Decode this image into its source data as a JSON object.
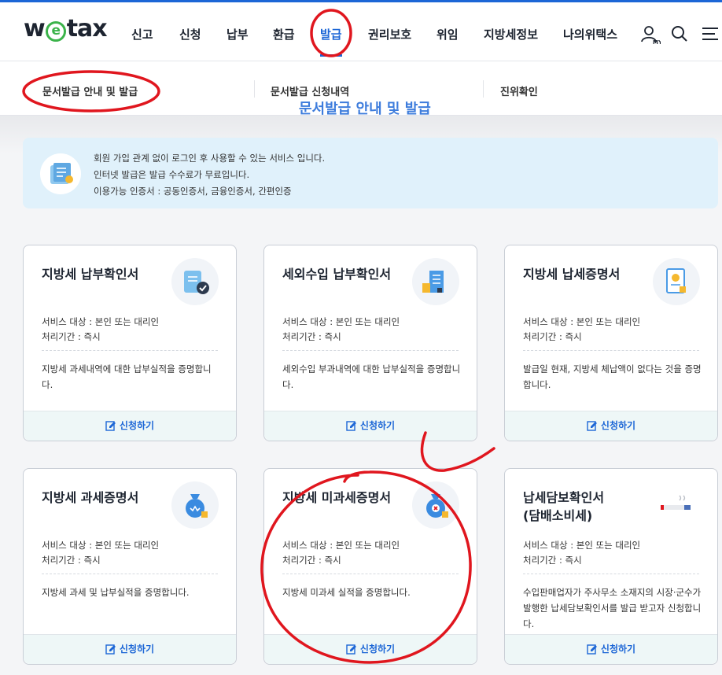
{
  "header": {
    "logo_text_1": "w",
    "logo_text_2": "e",
    "logo_text_3": "tax",
    "nav": [
      "신고",
      "신청",
      "납부",
      "환급",
      "발급",
      "권리보호",
      "위임",
      "지방세정보",
      "나의위택스"
    ],
    "active_nav": "발급",
    "my_label": "MY"
  },
  "subnav": {
    "items": [
      "문서발급 안내 및 발급",
      "문서발급 신청내역",
      "진위확인"
    ]
  },
  "page_title": "문서발급 안내 및 발급",
  "info": {
    "lines": [
      "회원 가입 관계 없이 로그인 후 사용할 수 있는 서비스 입니다.",
      "인터넷 발급은 발급 수수료가 무료입니다.",
      "이용가능 인증서 : 공동인증서, 금융인증서, 간편인증"
    ]
  },
  "cards": [
    {
      "title": "지방세 납부확인서",
      "target": "서비스 대상 : 본인 또는 대리인",
      "period": "처리기간 : 즉시",
      "desc": "지방세 과세내역에 대한 납부실적을 증명합니다.",
      "apply": "신청하기",
      "icon": "receipt-check-icon"
    },
    {
      "title": "세외수입 납부확인서",
      "target": "서비스 대상 : 본인 또는 대리인",
      "period": "처리기간 : 즉시",
      "desc": "세외수입 부과내역에 대한 납부실적을 증명합니다.",
      "apply": "신청하기",
      "icon": "building-document-icon"
    },
    {
      "title": "지방세 납세증명서",
      "target": "서비스 대상 : 본인 또는 대리인",
      "period": "처리기간 : 즉시",
      "desc": "발급일 현재, 지방세 체납액이 없다는 것을 증명합니다.",
      "apply": "신청하기",
      "icon": "certificate-icon"
    },
    {
      "title": "지방세 과세증명서",
      "target": "서비스 대상 : 본인 또는 대리인",
      "period": "처리기간 : 즉시",
      "desc": "지방세 과세 및 납부실적을 증명합니다.",
      "apply": "신청하기",
      "icon": "money-bag-icon"
    },
    {
      "title": "지방세 미과세증명서",
      "target": "서비스 대상 : 본인 또는 대리인",
      "period": "처리기간 : 즉시",
      "desc": "지방세 미과세 실적을 증명합니다.",
      "apply": "신청하기",
      "icon": "money-bag-x-icon"
    },
    {
      "title": "납세담보확인서\n(담배소비세)",
      "target": "서비스 대상 : 본인 또는 대리인",
      "period": "처리기간 : 즉시",
      "desc": "수입판매업자가 주사무소 소재지의 시장·군수가 발행한 납세담보확인서를 발급 받고자 신청합니다.",
      "apply": "신청하기",
      "icon": "cigarette-icon"
    }
  ],
  "colors": {
    "accent": "#1c66d6",
    "annotation": "#e0161e",
    "logo_green": "#3bb34a"
  }
}
